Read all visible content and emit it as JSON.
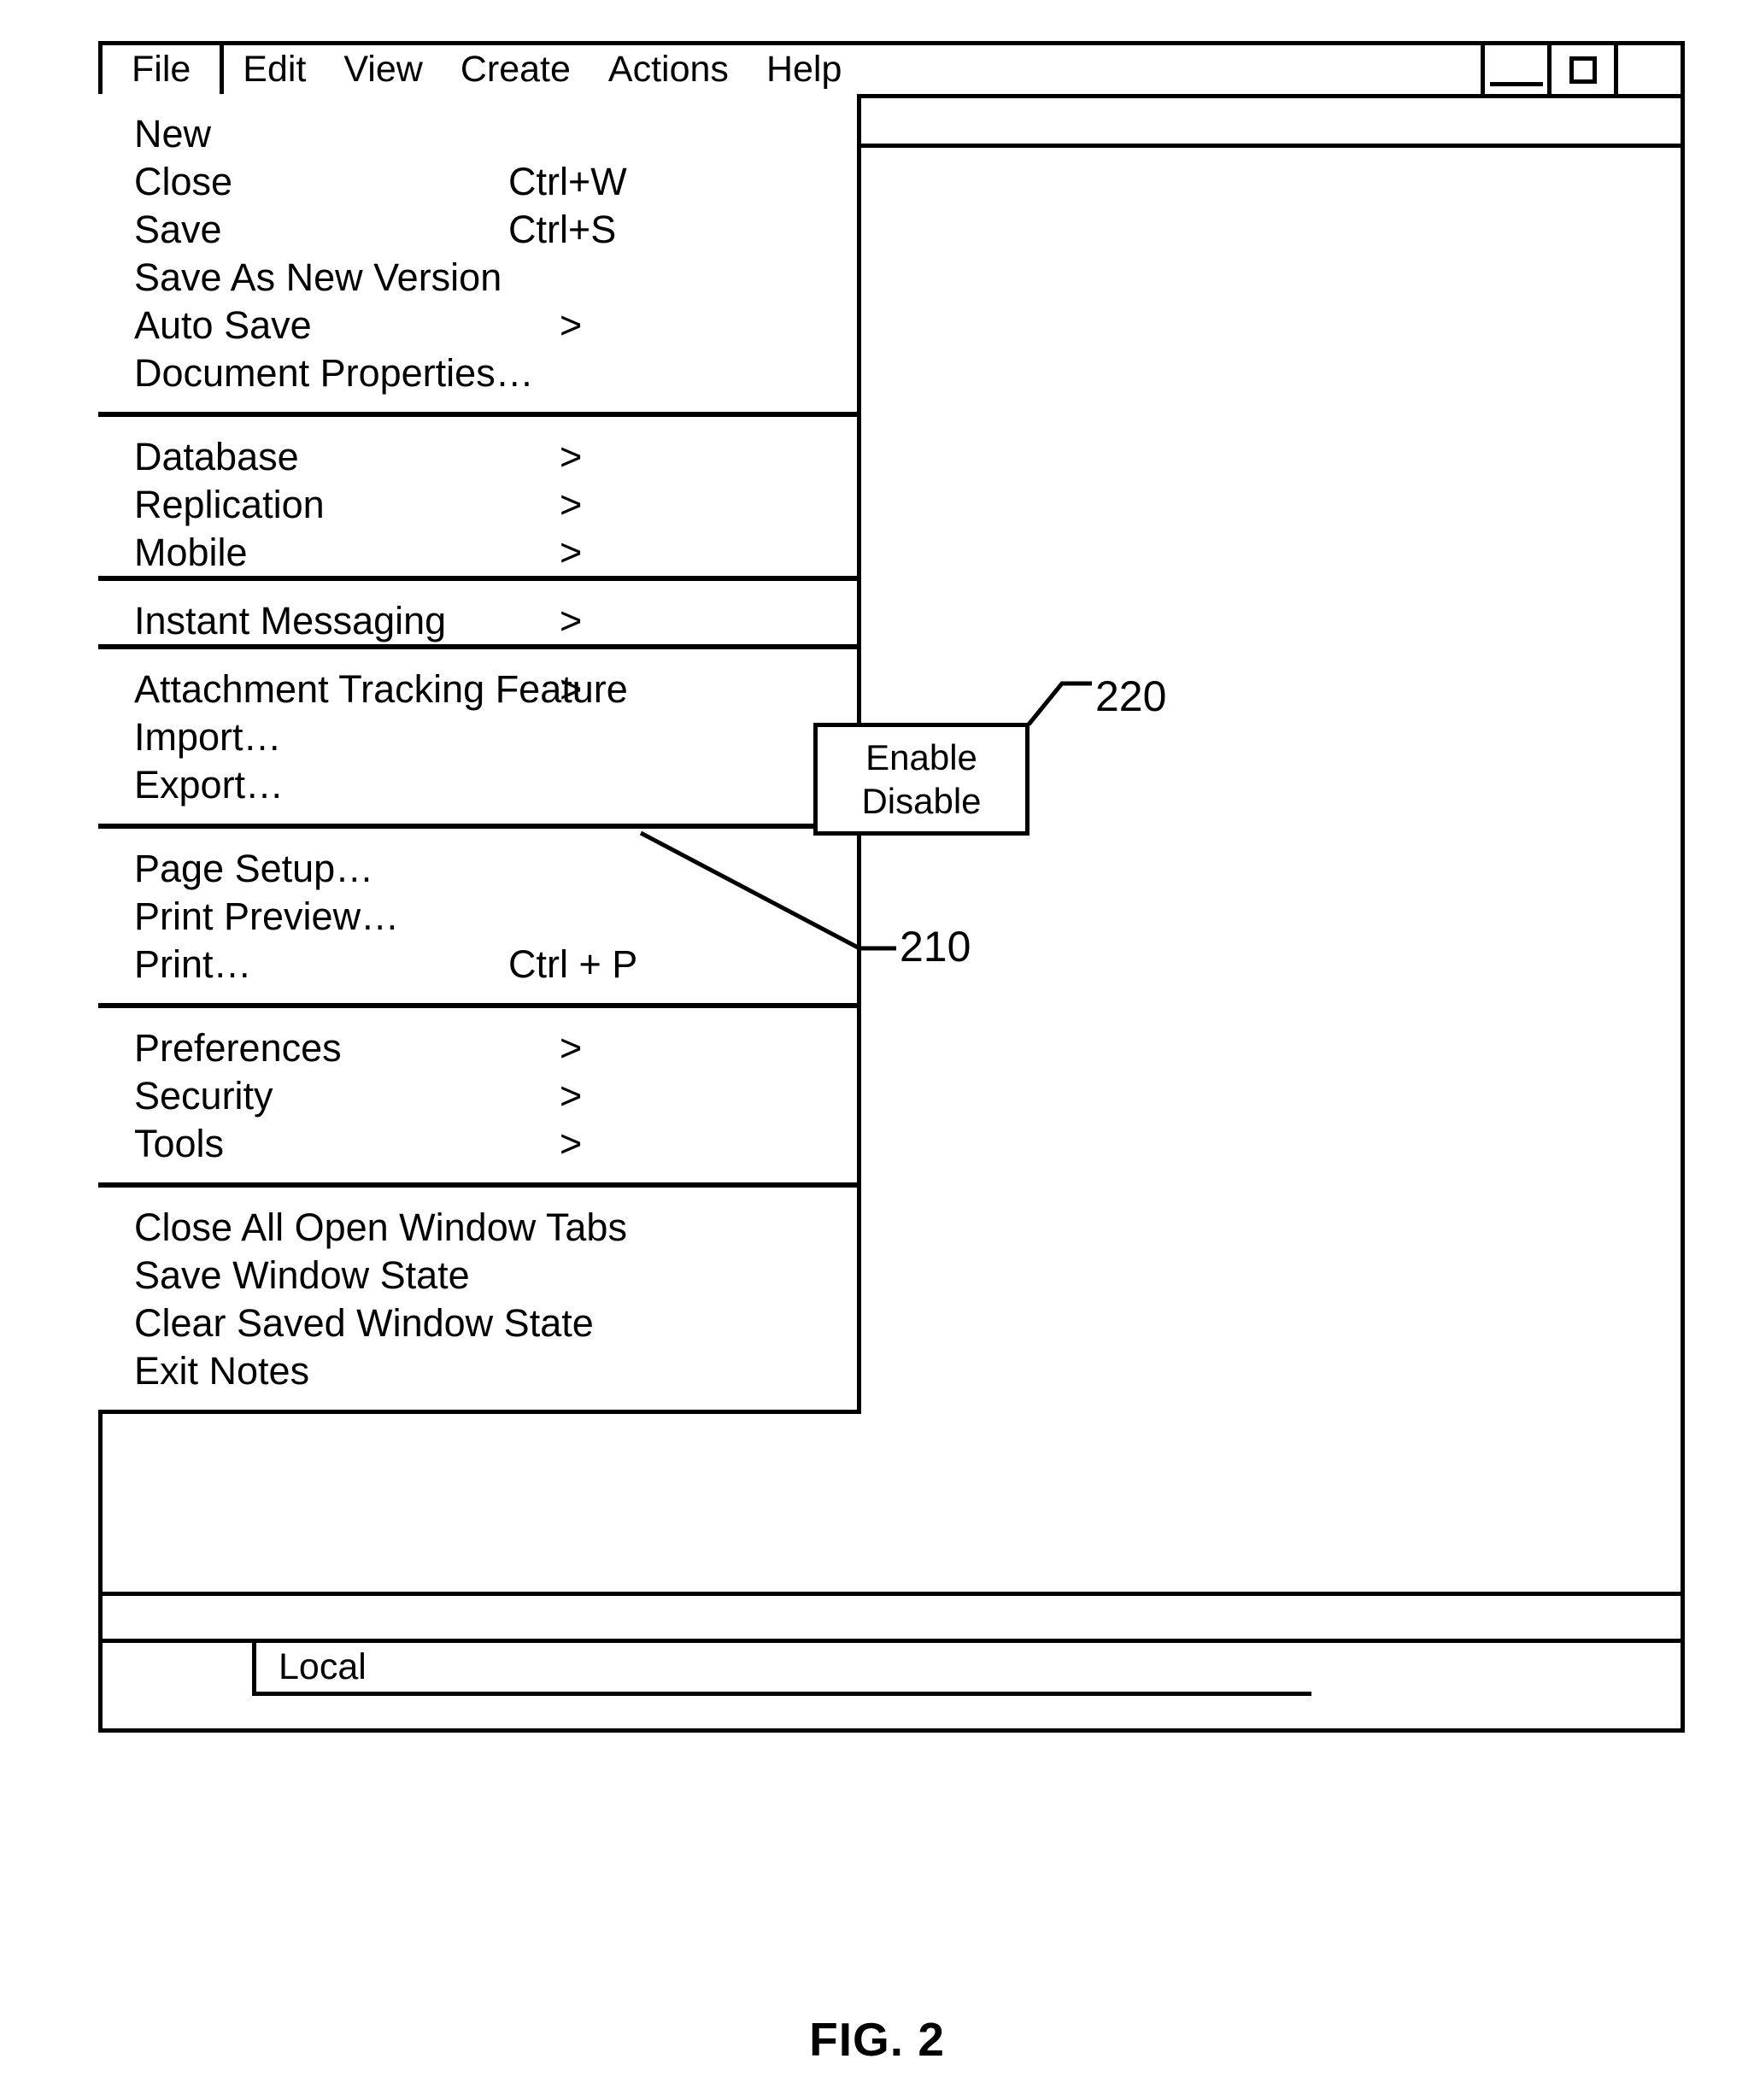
{
  "figure": {
    "caption": "FIG. 2"
  },
  "menubar": {
    "items": [
      {
        "label": "File",
        "active": true
      },
      {
        "label": "Edit",
        "active": false
      },
      {
        "label": "View",
        "active": false
      },
      {
        "label": "Create",
        "active": false
      },
      {
        "label": "Actions",
        "active": false
      },
      {
        "label": "Help",
        "active": false
      }
    ],
    "window_controls": [
      {
        "name": "minimize",
        "glyph": "minimize-icon"
      },
      {
        "name": "maximize",
        "glyph": "maximize-icon"
      },
      {
        "name": "close",
        "glyph": "close-icon"
      }
    ]
  },
  "file_menu": {
    "groups": [
      {
        "items": [
          {
            "label": "New",
            "accel": "",
            "arrow": ""
          },
          {
            "label": "Close",
            "accel": "Ctrl+W",
            "arrow": ""
          },
          {
            "label": "Save",
            "accel": "Ctrl+S",
            "arrow": ""
          },
          {
            "label": "Save As New Version",
            "accel": "",
            "arrow": ""
          },
          {
            "label": "Auto Save",
            "accel": "",
            "arrow": ">"
          },
          {
            "label": "Document Properties…",
            "accel": "",
            "arrow": ""
          }
        ]
      },
      {
        "items": [
          {
            "label": "Database",
            "accel": "",
            "arrow": ">"
          },
          {
            "label": "Replication",
            "accel": "",
            "arrow": ">"
          },
          {
            "label": "Mobile",
            "accel": "",
            "arrow": ">"
          }
        ]
      },
      {
        "items": [
          {
            "label": "Instant Messaging",
            "accel": "",
            "arrow": ">"
          }
        ]
      },
      {
        "items": [
          {
            "label": "Attachment Tracking Feature",
            "accel": "",
            "arrow": ">"
          },
          {
            "label": "Import…",
            "accel": "",
            "arrow": ""
          },
          {
            "label": "Export…",
            "accel": "",
            "arrow": ""
          }
        ]
      },
      {
        "items": [
          {
            "label": "Page Setup…",
            "accel": "",
            "arrow": ""
          },
          {
            "label": "Print Preview…",
            "accel": "",
            "arrow": ""
          },
          {
            "label": "Print…",
            "accel": "Ctrl + P",
            "arrow": ""
          }
        ]
      },
      {
        "items": [
          {
            "label": "Preferences",
            "accel": "",
            "arrow": ">"
          },
          {
            "label": "Security",
            "accel": "",
            "arrow": ">"
          },
          {
            "label": "Tools",
            "accel": "",
            "arrow": ">"
          }
        ]
      },
      {
        "items": [
          {
            "label": "Close All Open Window Tabs",
            "accel": "",
            "arrow": ""
          },
          {
            "label": "Save Window State",
            "accel": "",
            "arrow": ""
          },
          {
            "label": "Clear Saved Window State",
            "accel": "",
            "arrow": ""
          },
          {
            "label": "Exit Notes",
            "accel": "",
            "arrow": ""
          }
        ]
      }
    ]
  },
  "submenu": {
    "items": [
      {
        "label": "Enable"
      },
      {
        "label": "Disable"
      }
    ]
  },
  "callouts": [
    {
      "id": "220",
      "label": "220"
    },
    {
      "id": "210",
      "label": "210"
    }
  ],
  "status_bar": {
    "local_label": "Local"
  }
}
